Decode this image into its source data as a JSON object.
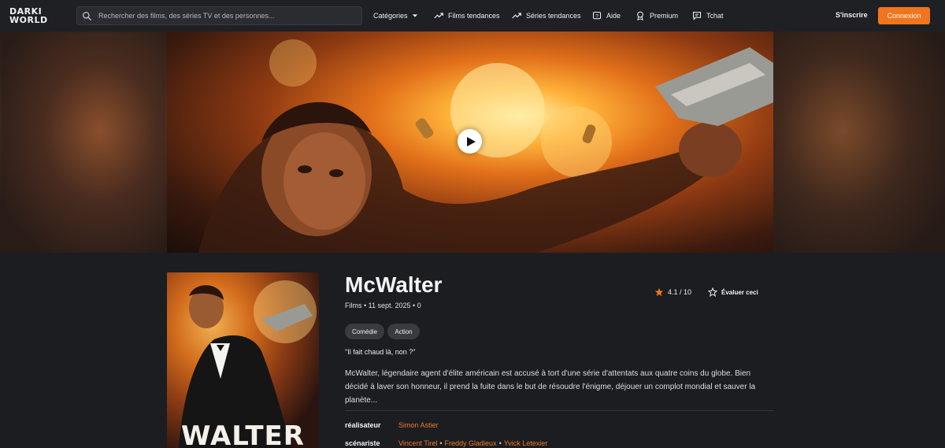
{
  "brand": {
    "line1": "DARKI",
    "line2": "WORLD"
  },
  "search": {
    "placeholder": "Rechercher des films, des séries TV et des personnes..."
  },
  "nav": {
    "categories": "Catégories",
    "trending_movies": "Films tendances",
    "trending_series": "Séries tendances",
    "help": "Aide",
    "premium": "Premium",
    "chat": "Tchat"
  },
  "auth": {
    "signup": "S'inscrire",
    "login": "Connexion"
  },
  "movie": {
    "title": "McWalter",
    "meta": "Films • 11 sept. 2025 • 0",
    "rating": "4.1 / 10",
    "rate_label": "Évaluer ceci",
    "genres": [
      "Comédie",
      "Action"
    ],
    "tagline": "\"Il fait chaud là, non ?\"",
    "overview": "McWalter, légendaire agent d'élite américain est accusé à tort d'une série d'attentats aux quatre coins du globe. Bien décidé à laver son honneur, il prend la fuite dans le but de résoudre l'énigme, déjouer un complot mondial et sauver la planète...",
    "poster_text": "WALTER",
    "credits": [
      {
        "label": "réalisateur",
        "people": [
          "Simon Astier"
        ]
      },
      {
        "label": "scénariste",
        "people": [
          "Vincent Tirel",
          "Freddy Gladieux",
          "Yvick Letexier"
        ]
      }
    ]
  },
  "colors": {
    "accent": "#f0751c",
    "background": "#1c1d21",
    "link": "#f07a25"
  },
  "icons": {
    "search": "search-icon",
    "play": "play-icon",
    "star": "star-icon"
  }
}
